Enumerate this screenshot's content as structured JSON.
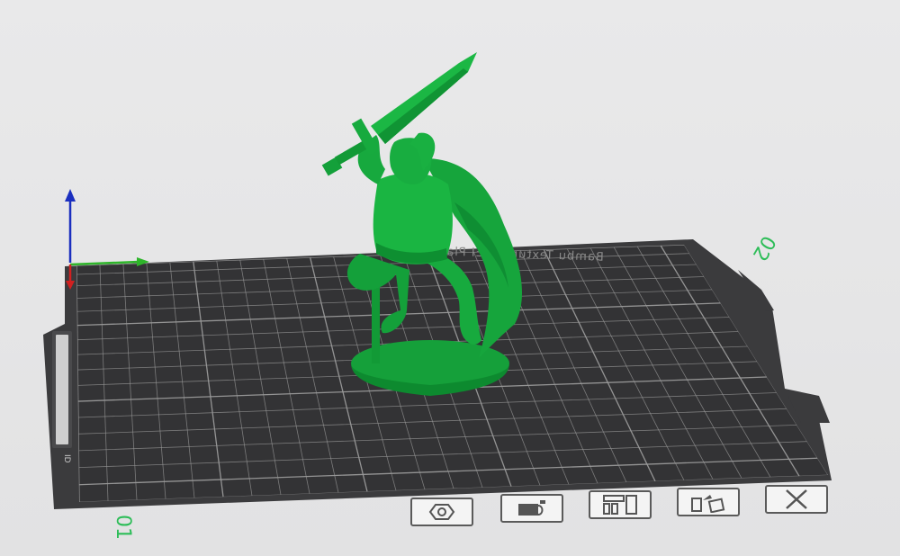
{
  "bed": {
    "label": "Bambu Textured PEI Plate",
    "texture": "textured-pei",
    "color": "#3b3b3d",
    "grid_color": "#9a9a9a",
    "side_slot_text": "ID"
  },
  "plates": {
    "front_number": "01",
    "back_number": "02",
    "number_color": "#2dbd58"
  },
  "model": {
    "name": "warrior-figure",
    "color": "#18a83d"
  },
  "axes": {
    "x_color": "#2eb52a",
    "y_color": "#d22020",
    "z_color": "#1b2fbf"
  },
  "plate_toolbar": [
    {
      "name": "auto-orient-button",
      "icon": "hexagon-nut-icon"
    },
    {
      "name": "arrange-button",
      "icon": "plate-lock-icon"
    },
    {
      "name": "plate-settings-button",
      "icon": "layout-icon"
    },
    {
      "name": "move-object-button",
      "icon": "move-icon"
    },
    {
      "name": "delete-plate-button",
      "icon": "close-icon"
    }
  ]
}
